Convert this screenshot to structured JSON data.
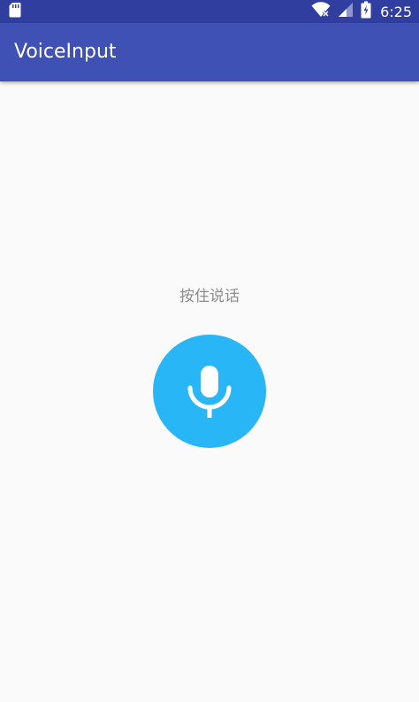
{
  "status_bar": {
    "time": "6:25",
    "icons": [
      "sd-card-icon",
      "wifi-icon",
      "signal-icon",
      "battery-icon"
    ]
  },
  "app_bar": {
    "title": "VoiceInput"
  },
  "main": {
    "hint": "按住说话",
    "mic_button": {
      "icon": "microphone-icon",
      "color": "#29b6f6"
    }
  },
  "colors": {
    "status_bar": "#303f9f",
    "app_bar": "#3f51b5",
    "background": "#fafafa",
    "accent": "#29b6f6"
  }
}
